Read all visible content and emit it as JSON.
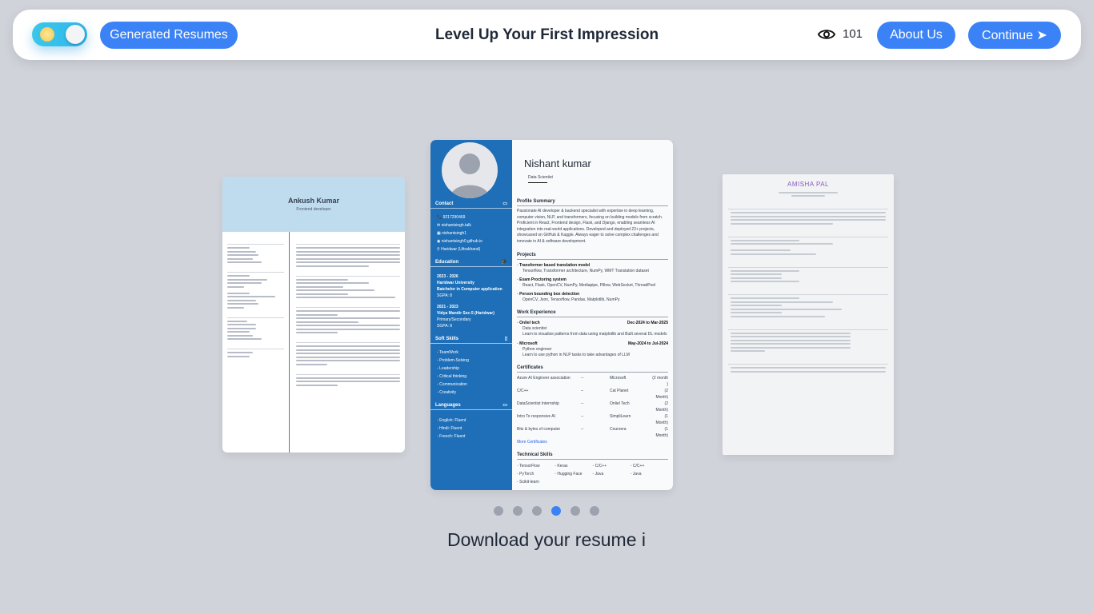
{
  "header": {
    "generated_label": "Generated Resumes",
    "title": "Level Up Your First Impression",
    "views": "101",
    "about_label": "About Us",
    "continue_label": "Continue ➤"
  },
  "carousel": {
    "left": {
      "name": "Ankush Kumar",
      "role": "Frontend developer"
    },
    "center": {
      "name": "Nishant kumar",
      "role": "Data Scientist",
      "contact_title": "Contact",
      "contact": [
        "9217290469",
        "nishantsingh.talk",
        "nishantsingh1",
        "nishantsingh0.github.io",
        "Haridwar (Uttrakhand)"
      ],
      "education_title": "Education",
      "edu1": {
        "years": "2023 - 2026",
        "school": "Haridwar University",
        "degree": "Batchelor in Computer application",
        "score": "SGPA: 8"
      },
      "edu2": {
        "years": "2021 - 2023",
        "school": "Vidya Mandir Sec-5 (Haridwar)",
        "degree": "Primary/Secondary",
        "score": "SGPA: 8"
      },
      "soft_title": "Soft Skills",
      "soft": [
        "TeamWork",
        "Problem-Solving",
        "Leadership",
        "Critical thinking",
        "Communication",
        "Creativity"
      ],
      "lang_title": "Languages",
      "langs": [
        "English: Fluent",
        "Hindi: Fluent",
        "French: Fluent"
      ],
      "summary_title": "Profile Summary",
      "summary": "Passionate AI developer & backend specialist with expertise in deep learning, computer vision, NLP, and transformers, focusing on building models from scratch. Proficient in React, Frontend design, Flask, and Django, enabling seamless AI integration into real-world applications. Developed and deployed 22+ projects, showcased on GitHub & Kaggle. Always eager to solve complex challenges and innovate in AI & software development.",
      "projects_title": "Projects",
      "projects": [
        {
          "name": "Transformer based translation model",
          "tech": "Tensorflow, Transformer architecture, NumPy, WMT Translation dataset"
        },
        {
          "name": "Exam Proctoring system",
          "tech": "React, Flask, OpenCV, NumPy, Mediapipe, Pillow, WebSocket, ThreadPool"
        },
        {
          "name": "Person bounding box detection",
          "tech": "OpenCV, Json, Tensorflow, Pandas, Matplotlib, NumPy"
        }
      ],
      "work_title": "Work Experience",
      "work": [
        {
          "company": "Onliel tech",
          "dates": "Dec-2024 to Mar-2025",
          "role": "Data scientist",
          "desc": "Learn to visualize patterns from data using matplotlib and Built several DL models"
        },
        {
          "company": "Microsoft",
          "dates": "May-2024 to Jul-2024",
          "role": "Python engineer",
          "desc": "Learn to use python in NLP tasks to take advantages of LLM"
        }
      ],
      "cert_title": "Certificates",
      "certs": [
        [
          "Azure AI Engineer association",
          "--",
          "Microsoft",
          "(2 month )"
        ],
        [
          "C/C++",
          "--",
          "Cat Planet",
          "(2 Month)"
        ],
        [
          "DataScientist Internship",
          "--",
          "Onliel Tech",
          "(2 Month)"
        ],
        [
          "Intro To responsive AI",
          "--",
          "SimpliLearn",
          "(1 Month)"
        ],
        [
          "Bits & bytes of computer",
          "--",
          "Coursera",
          "(1 Month)"
        ]
      ],
      "more_certs": "More Certificates",
      "tech_title": "Technical Skills",
      "tech": [
        "TensorFlow",
        "Keras",
        "C/C++",
        "C/C++",
        "PyTorch",
        "Hugging Face",
        "Java",
        "Java",
        "Scikit-learn"
      ]
    },
    "right": {
      "name": "AMISHA PAL"
    }
  },
  "pagination": {
    "count": 6,
    "active_index": 3
  },
  "caption": "Download your resume i"
}
